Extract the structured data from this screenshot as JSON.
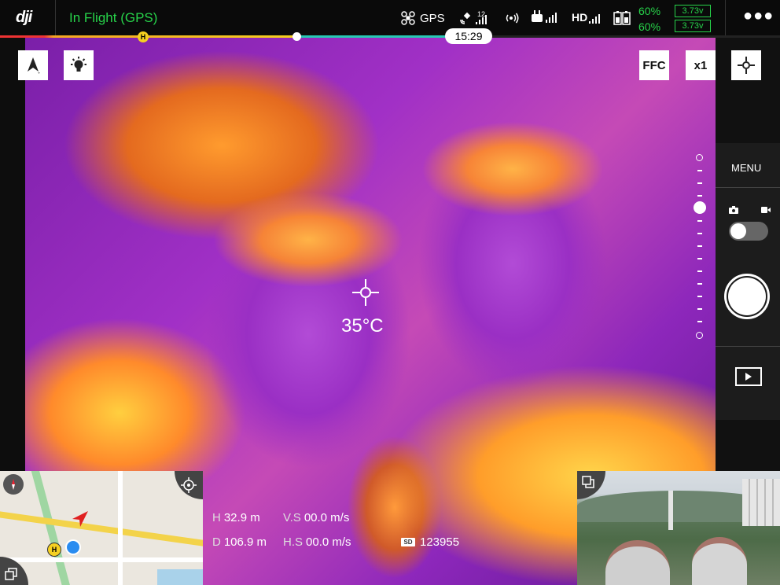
{
  "top_bar": {
    "logo": "dji",
    "flight_status": "In Flight (GPS)",
    "gps_label": "GPS",
    "satellite_count": "12",
    "video_link_label": "HD",
    "battery_percent_1": "60%",
    "battery_percent_2": "60%",
    "battery_voltage_1": "3.73v",
    "battery_voltage_2": "3.73v",
    "more_icon": "more-dots-icon"
  },
  "flight_progress": {
    "home_marker": "H",
    "remaining_time": "15:29",
    "used_fraction": 0.38
  },
  "toolbar": {
    "ffc_label": "FFC",
    "zoom_label": "x1"
  },
  "center": {
    "spot_temperature": "35°C"
  },
  "right_panel": {
    "menu_label": "MENU"
  },
  "map": {
    "home_label": "H"
  },
  "telemetry": {
    "h_label": "H",
    "h_value": "32.9 m",
    "vs_label": "V.S",
    "vs_value": "00.0 m/s",
    "d_label": "D",
    "d_value": "106.9 m",
    "hs_label": "H.S",
    "hs_value": "00.0 m/s",
    "sd_label": "SD",
    "sd_value": "123955"
  },
  "colors": {
    "status_green": "#27d34a",
    "progress_teal": "#27c9b3",
    "home_yellow": "#f5d020"
  }
}
